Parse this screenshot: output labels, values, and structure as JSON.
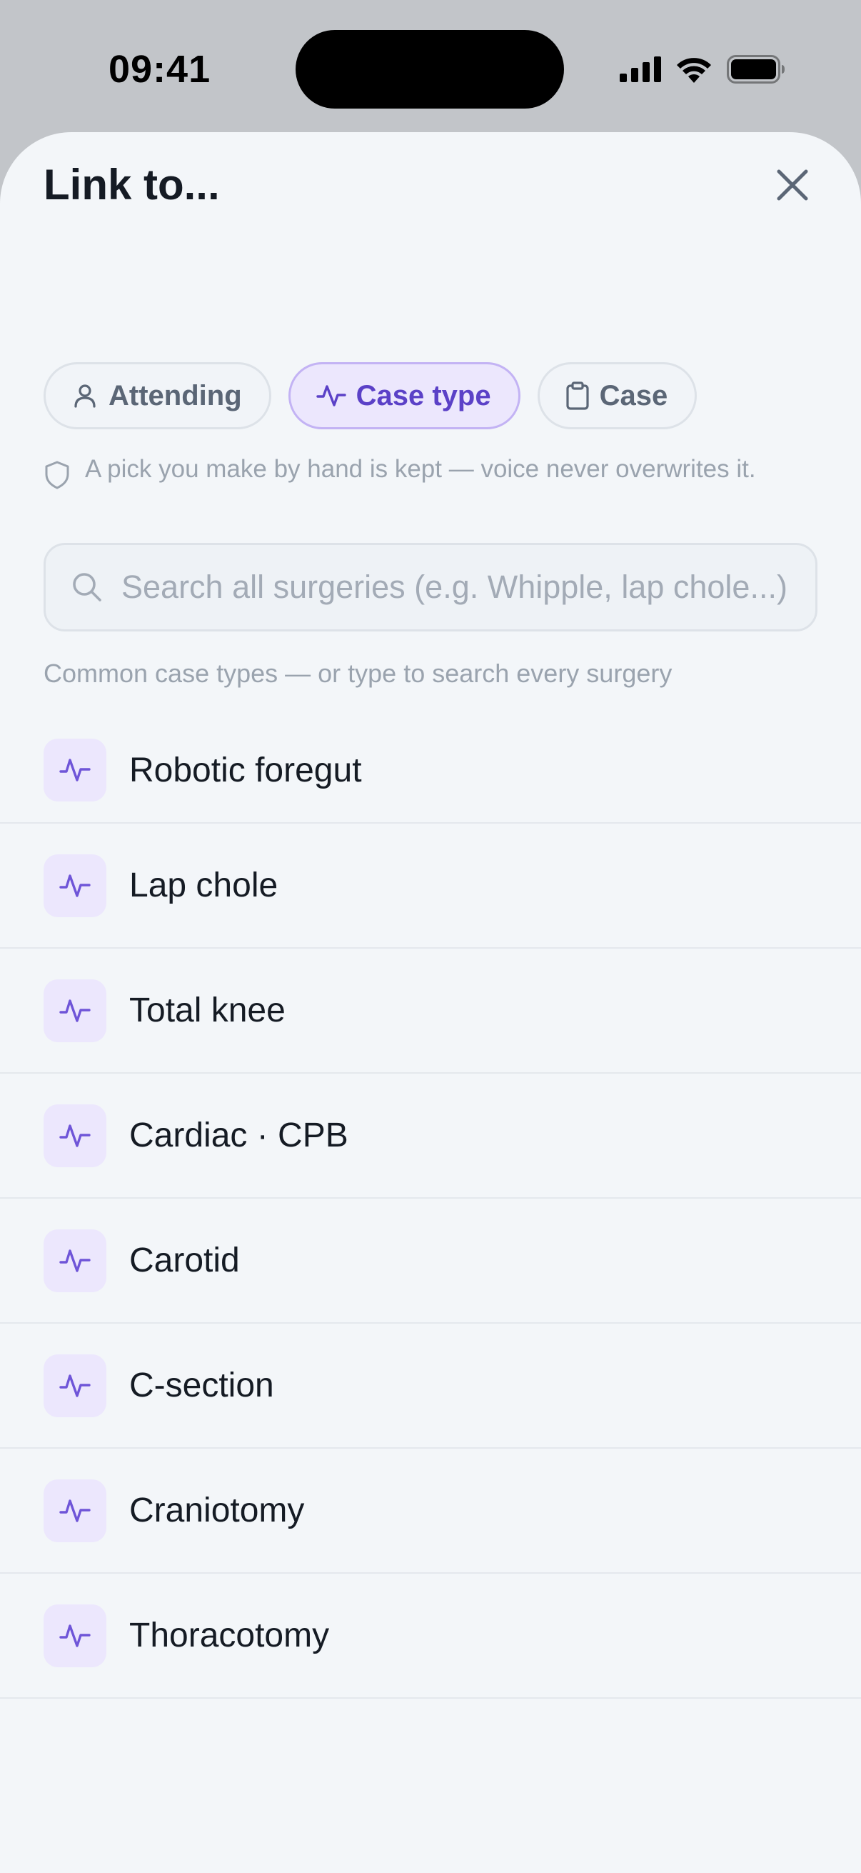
{
  "status_bar": {
    "time": "09:41"
  },
  "sheet": {
    "title": "Link to...",
    "tabs": [
      {
        "label": "Attending",
        "icon": "person-icon",
        "active": false
      },
      {
        "label": "Case type",
        "icon": "pulse-icon",
        "active": true
      },
      {
        "label": "Case",
        "icon": "clipboard-icon",
        "active": false
      }
    ],
    "hint": "A pick you make by hand is kept — voice never overwrites it.",
    "search": {
      "placeholder": "Search all surgeries (e.g. Whipple, lap chole...)",
      "value": ""
    },
    "section_label": "Common case types — or type to search every surgery",
    "items": [
      {
        "label": "Robotic foregut"
      },
      {
        "label": "Lap chole"
      },
      {
        "label": "Total knee"
      },
      {
        "label": "Cardiac · CPB"
      },
      {
        "label": "Carotid"
      },
      {
        "label": "C-section"
      },
      {
        "label": "Craniotomy"
      },
      {
        "label": "Thoracotomy"
      }
    ]
  },
  "colors": {
    "accent": "#5b41c7",
    "accent_bg": "#ece7fd",
    "sheet_bg": "#f3f6f9",
    "backdrop": "#c2c5c9"
  }
}
